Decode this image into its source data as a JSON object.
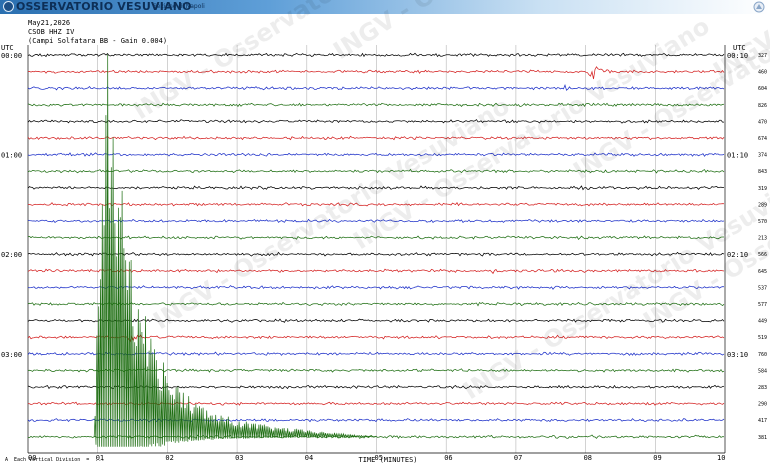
{
  "header": {
    "brand": "OSSERVATORIO VESUVIANO",
    "section": "Sezione di Napoli"
  },
  "meta": {
    "date": "May21,2026",
    "station": "CSOB HHZ IV",
    "site": "(Campi Solfatara BB - Gain 0.004)"
  },
  "timezone_left": "UTC",
  "timezone_right": "UTC",
  "footer_note": "A  Each Vertical Division  =  ...",
  "watermark": "INGV - Osservatorio Vesuviano",
  "colors": {
    "black": "#000000",
    "red": "#d42020",
    "blue": "#1c2fc8",
    "green": "#1e6e12",
    "grid": "#b4b4b4"
  },
  "chart_data": {
    "type": "line",
    "title": "",
    "xlabel": "TIME (MINUTES)",
    "xlim": [
      0,
      10
    ],
    "x_ticks": [
      0,
      1,
      2,
      3,
      4,
      5,
      6,
      7,
      8,
      9,
      10
    ],
    "trace_interval_minutes": 10,
    "color_cycle": [
      "black",
      "red",
      "blue",
      "green"
    ],
    "row_labels_left": [
      "00:00",
      "01:00",
      "02:00",
      "03:00"
    ],
    "row_labels_left_rows": [
      0,
      6,
      12,
      18
    ],
    "row_labels_right": [
      "00:10",
      "01:10",
      "02:10",
      "03:10"
    ],
    "row_labels_right_rows": [
      0,
      6,
      12,
      18
    ],
    "trace_counts": [
      327,
      460,
      604,
      826,
      470,
      674,
      374,
      843,
      319,
      289,
      570,
      213,
      566,
      645,
      537,
      577,
      449,
      519,
      760,
      584,
      283,
      290,
      417,
      381
    ],
    "events": [
      {
        "row": 1,
        "minute": 8.05,
        "amplitude": 1.0,
        "duration_min": 0.35
      },
      {
        "row": 2,
        "minute": 7.7,
        "amplitude": 0.35,
        "duration_min": 0.1
      },
      {
        "row": 3,
        "minute": 1.55,
        "amplitude": 0.4,
        "duration_min": 0.1
      },
      {
        "row": 8,
        "minute": 3.9,
        "amplitude": 0.35,
        "duration_min": 0.15
      },
      {
        "row": 8,
        "minute": 7.9,
        "amplitude": 0.3,
        "duration_min": 0.15
      },
      {
        "row": 13,
        "minute": 6.65,
        "amplitude": 0.3,
        "duration_min": 0.1
      },
      {
        "row": 17,
        "minute": 1.45,
        "amplitude": 0.6,
        "duration_min": 0.2
      }
    ],
    "large_event": {
      "row": 23,
      "onset_minute": 0.95,
      "peak_minute": 1.1,
      "coda_end_minute": 5.0,
      "peak_reach_rows_up": 24,
      "coda_reach_rows_up": 1.5
    }
  }
}
